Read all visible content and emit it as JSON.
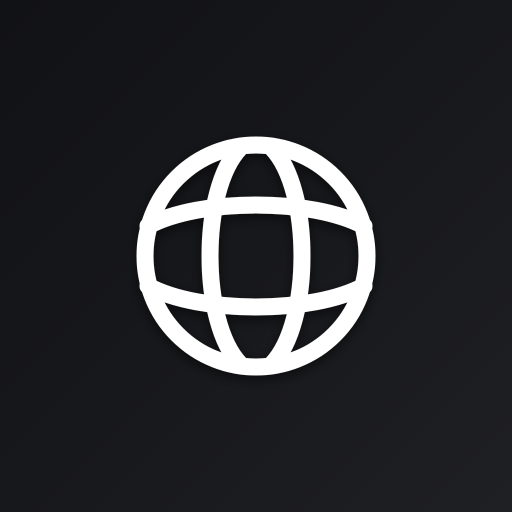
{
  "icon": {
    "name": "globe-icon",
    "color": "#ffffff"
  },
  "colors": {
    "background_start": "#111215",
    "background_end": "#1f2024",
    "shadow": "#000000"
  }
}
